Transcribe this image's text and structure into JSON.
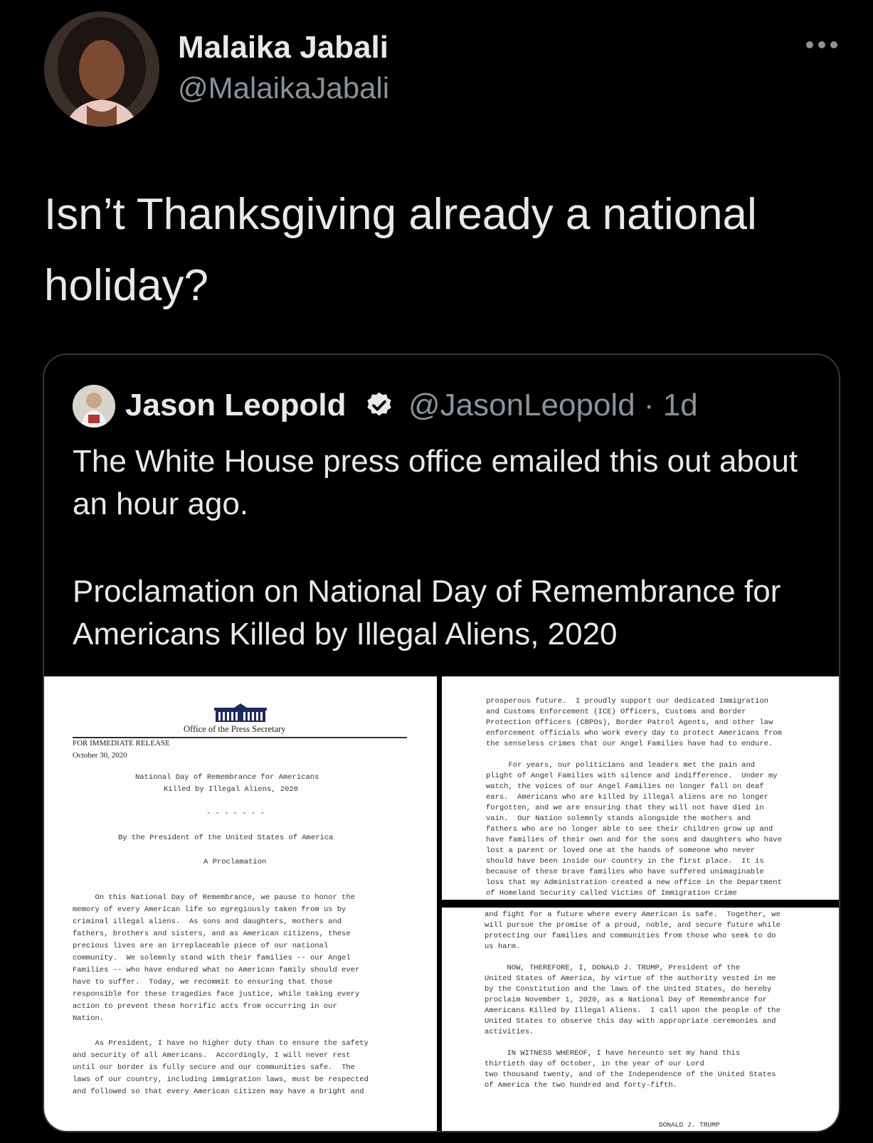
{
  "tweet": {
    "author_name": "Malaika Jabali",
    "author_handle": "@MalaikaJabali",
    "text": "Isn’t Thanksgiving already a national holiday?"
  },
  "quoted": {
    "author_name": "Jason Leopold",
    "author_handle": "@JasonLeopold · 1d",
    "verified_icon": "verified-badge-icon",
    "text_line1": "The White House press office emailed this out about an hour ago.",
    "text_line2": "Proclamation on National Day of Remembrance for Americans Killed by Illegal Aliens, 2020"
  },
  "doc1": {
    "office": "Office of the Press Secretary",
    "release": "FOR IMMEDIATE RELEASE",
    "date": "October 30, 2020",
    "title_1": "National Day of Remembrance for Americans",
    "title_2": "Killed by Illegal Aliens, 2020",
    "dashes": "- - - - - - -",
    "by_line": "By the President of the United States of America",
    "proclamation": "A Proclamation",
    "para1": [
      "     On this National Day of Remembrance, we pause to honor the",
      "memory of every American life so egregiously taken from us by",
      "criminal illegal aliens.  As sons and daughters, mothers and",
      "fathers, brothers and sisters, and as American citizens, these",
      "precious lives are an irreplaceable piece of our national",
      "community.  We solemnly stand with their families -- our Angel",
      "Families -- who have endured what no American family should ever",
      "have to suffer.  Today, we recommit to ensuring that those",
      "responsible for these tragedies face justice, while taking every",
      "action to prevent these horrific acts from occurring in our",
      "Nation."
    ],
    "para2": [
      "     As President, I have no higher duty than to ensure the safety",
      "and security of all Americans.  Accordingly, I will never rest",
      "until our border is fully secure and our communities safe.  The",
      "laws of our country, including immigration laws, must be respected",
      "and followed so that every American citizen may have a bright and"
    ]
  },
  "doc2": {
    "para1": [
      "prosperous future.  I proudly support our dedicated Immigration",
      "and Customs Enforcement (ICE) Officers, Customs and Border",
      "Protection Officers (CBPOs), Border Patrol Agents, and other law",
      "enforcement officials who work every day to protect Americans from",
      "the senseless crimes that our Angel Families have had to endure."
    ],
    "para2": [
      "     For years, our politicians and leaders met the pain and",
      "plight of Angel Families with silence and indifference.  Under my",
      "watch, the voices of our Angel Families no longer fall on deaf",
      "ears.  Americans who are killed by illegal aliens are no longer",
      "forgotten, and we are ensuring that they will not have died in",
      "vain.  Our Nation solemnly stands alongside the mothers and",
      "fathers who are no longer able to see their children grow up and",
      "have families of their own and for the sons and daughters who have",
      "lost a parent or loved one at the hands of someone who never",
      "should have been inside our country in the first place.  It is",
      "because of these brave families who have suffered unimaginable",
      "loss that my Administration created a new office in the Department",
      "of Homeland Security called Victims Of Immigration Crime"
    ]
  },
  "doc3": {
    "para1": [
      "and fight for a future where every American is safe.  Together, we",
      "will pursue the promise of a proud, noble, and secure future while",
      "protecting our families and communities from those who seek to do",
      "us harm."
    ],
    "para2": [
      "     NOW, THEREFORE, I, DONALD J. TRUMP, President of the",
      "United States of America, by virtue of the authority vested in me",
      "by the Constitution and the laws of the United States, do hereby",
      "proclaim November 1, 2020, as a National Day of Remembrance for",
      "Americans Killed by Illegal Aliens.  I call upon the people of the",
      "United States to observe this day with appropriate ceremonies and",
      "activities."
    ],
    "para3": [
      "     IN WITNESS WHEREOF, I have hereunto set my hand this",
      "thirtieth day of October, in the year of our Lord",
      "two thousand twenty, and of the Independence of the United States",
      "of America the two hundred and forty-fifth."
    ],
    "signature": "DONALD J. TRUMP"
  }
}
